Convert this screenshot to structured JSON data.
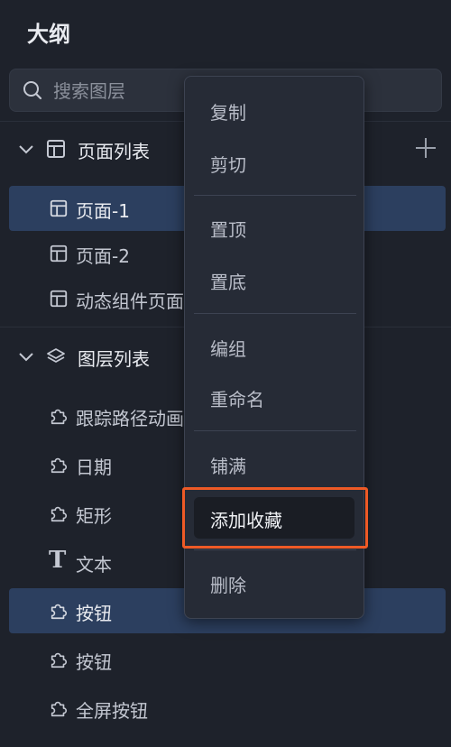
{
  "panel": {
    "title": "大纲"
  },
  "search": {
    "placeholder": "搜索图层"
  },
  "pages_section": {
    "label": "页面列表",
    "items": [
      {
        "label": "页面-1"
      },
      {
        "label": "页面-2"
      },
      {
        "label": "动态组件页面"
      }
    ]
  },
  "layers_section": {
    "label": "图层列表",
    "items": [
      {
        "label": "跟踪路径动画"
      },
      {
        "label": "日期"
      },
      {
        "label": "矩形"
      },
      {
        "label": "文本"
      },
      {
        "label": "按钮"
      },
      {
        "label": "按钮"
      },
      {
        "label": "全屏按钮"
      }
    ]
  },
  "context_menu": {
    "items": [
      {
        "label": "复制"
      },
      {
        "label": "剪切"
      },
      {
        "label": "置顶"
      },
      {
        "label": "置底"
      },
      {
        "label": "编组"
      },
      {
        "label": "重命名"
      },
      {
        "label": "铺满"
      },
      {
        "label": "添加收藏"
      },
      {
        "label": "删除"
      }
    ]
  },
  "icons": {
    "layer_item": "puzzle-icon",
    "text_item": "text-t-icon",
    "page_item": "layout-icon"
  },
  "colors": {
    "background": "#1e222b",
    "selected_row": "#2c3f5f",
    "highlight_border": "#ee5a26"
  }
}
